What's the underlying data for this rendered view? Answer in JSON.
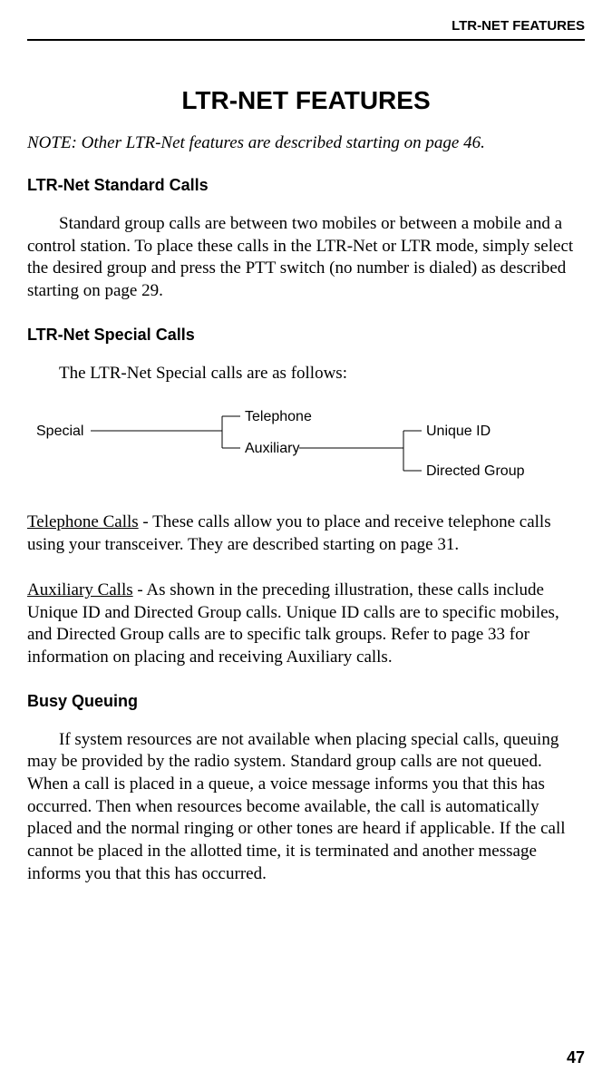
{
  "header": {
    "label": "LTR-NET FEATURES"
  },
  "title": "LTR-NET FEATURES",
  "note": "NOTE: Other LTR-Net features are described starting on page 46.",
  "sections": {
    "standard_calls": {
      "heading": "LTR-Net Standard Calls",
      "body": "Standard group calls are between two mobiles or between a mobile and a control station. To place these calls in the LTR-Net or LTR mode, simply select the desired group and press the PTT switch (no number is dialed) as described starting on page 29."
    },
    "special_calls": {
      "heading": "LTR-Net Special Calls",
      "intro": "The LTR-Net Special calls are as follows:",
      "diagram": {
        "special": "Special",
        "telephone": "Telephone",
        "auxiliary": "Auxiliary",
        "unique_id": "Unique ID",
        "directed_group": "Directed Group"
      },
      "telephone_label": "Telephone Calls",
      "telephone_body": " - These calls allow you to place and receive telephone calls using your transceiver. They are described starting on page 31.",
      "auxiliary_label": "Auxiliary Calls",
      "auxiliary_body": " - As shown in the preceding illustration, these calls include Unique ID and Directed Group calls. Unique ID calls are to specific mobiles, and Directed Group calls are to specific talk groups. Refer to page 33 for information on placing and receiving Auxiliary calls."
    },
    "busy_queuing": {
      "heading": "Busy Queuing",
      "body": "If system resources are not available when placing special calls, queuing may be provided by the radio system. Standard group calls are not queued. When a call is placed in a queue, a voice message informs you that this has occurred. Then when resources become available, the call is automatically placed and the normal ringing or other tones are heard if applicable. If the call cannot be placed in the allotted time, it is terminated and another message informs you that this has occurred."
    }
  },
  "page_number": "47"
}
